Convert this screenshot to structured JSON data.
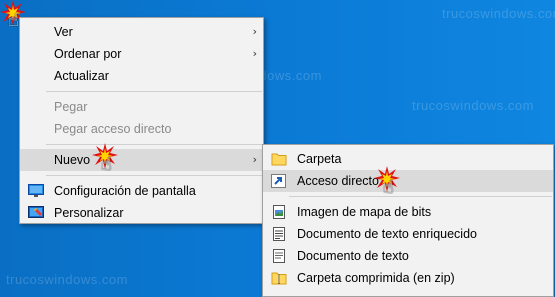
{
  "watermark": "trucoswindows.com",
  "context_menu": {
    "items": [
      {
        "label": "Ver",
        "has_submenu": true
      },
      {
        "label": "Ordenar por",
        "has_submenu": true
      },
      {
        "label": "Actualizar"
      },
      {
        "label": "Pegar",
        "disabled": true
      },
      {
        "label": "Pegar acceso directo",
        "disabled": true
      },
      {
        "label": "Nuevo",
        "has_submenu": true,
        "highlighted": true
      },
      {
        "label": "Configuración de pantalla",
        "icon": "display-settings-icon"
      },
      {
        "label": "Personalizar",
        "icon": "personalize-icon"
      }
    ],
    "submenu_arrow": "›"
  },
  "new_submenu": {
    "items": [
      {
        "label": "Carpeta",
        "icon": "folder-icon"
      },
      {
        "label": "Acceso directo",
        "icon": "shortcut-icon",
        "highlighted": true
      },
      {
        "label": "Imagen de mapa de bits",
        "icon": "bitmap-icon"
      },
      {
        "label": "Documento de texto enriquecido",
        "icon": "rtf-document-icon"
      },
      {
        "label": "Documento de texto",
        "icon": "text-document-icon"
      },
      {
        "label": "Carpeta comprimida (en zip)",
        "icon": "zip-folder-icon"
      }
    ]
  },
  "colors": {
    "desktop": "#0b7bd6",
    "menu_bg": "#f2f2f2",
    "highlight": "#dadada",
    "disabled_text": "#8a8a8a"
  }
}
